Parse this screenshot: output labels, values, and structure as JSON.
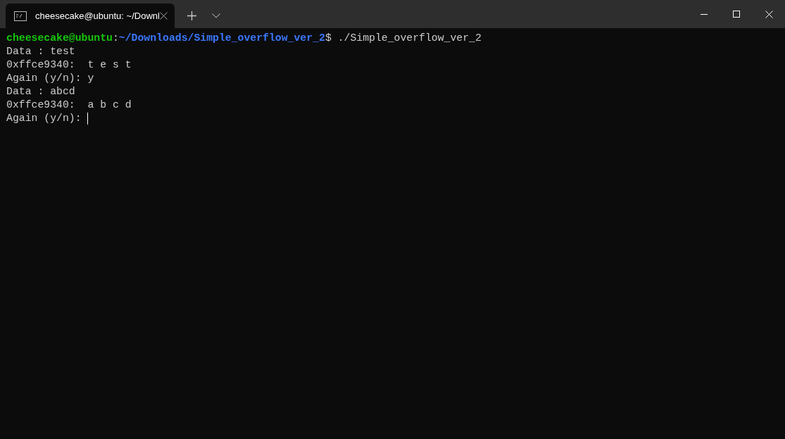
{
  "tab": {
    "title": "cheesecake@ubuntu: ~/Downl",
    "selected": true
  },
  "lines": [
    {
      "kind": "prompt",
      "user_host": "cheesecake@ubuntu",
      "separator": ":",
      "path": "~/Downloads/Simple_overflow_ver_2",
      "command": "$ ./Simple_overflow_ver_2"
    },
    {
      "kind": "output",
      "text": "Data : test"
    },
    {
      "kind": "output",
      "text": "0xffce9340:  t e s t"
    },
    {
      "kind": "output",
      "text": "Again (y/n): y"
    },
    {
      "kind": "output",
      "text": "Data : abcd"
    },
    {
      "kind": "output",
      "text": "0xffce9340:  a b c d"
    },
    {
      "kind": "output",
      "text": "Again (y/n): ",
      "cursor": true
    }
  ]
}
